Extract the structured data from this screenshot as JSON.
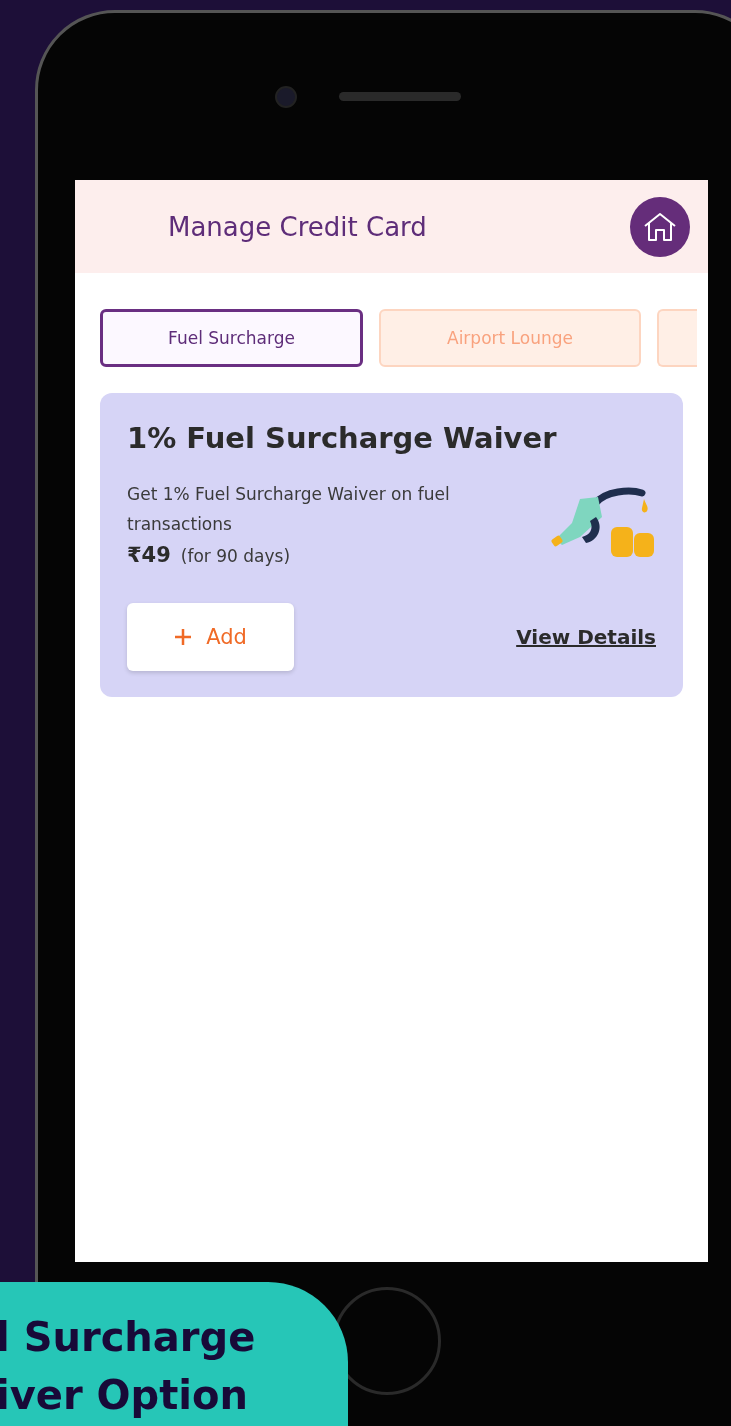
{
  "app_bar": {
    "title": "Manage Credit Card"
  },
  "tabs": [
    {
      "label": "Fuel Surcharge",
      "selected": true
    },
    {
      "label": "Airport Lounge",
      "selected": false
    }
  ],
  "offer": {
    "title": "1% Fuel Surcharge Waiver",
    "description": "Get 1% Fuel Surcharge Waiver on fuel transactions",
    "price": "₹49",
    "duration": "(for 90 days)",
    "add_button": "Add",
    "details_link": "View Details"
  },
  "caption": {
    "lines": [
      "l Surcharge",
      "iver Option"
    ]
  }
}
